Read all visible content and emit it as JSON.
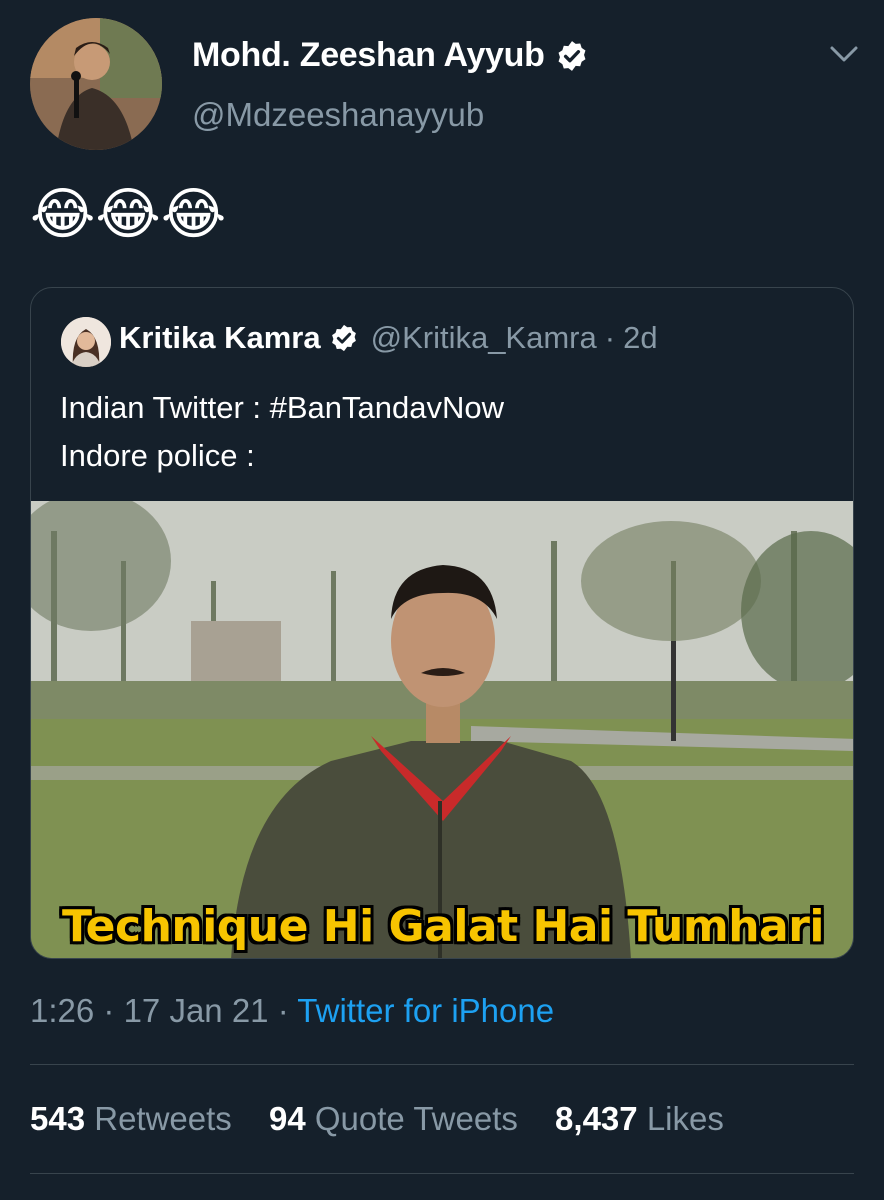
{
  "tweet": {
    "author": {
      "name": "Mohd. Zeeshan Ayyub",
      "handle": "@Mdzeeshanayyub"
    },
    "text": "😂😂😂",
    "quoted": {
      "name": "Kritika Kamra",
      "handle": "@Kritika_Kamra",
      "separator": "·",
      "age": "2d",
      "line1": "Indian Twitter : #BanTandavNow",
      "line2": "Indore police :",
      "image_caption": "Technique Hi Galat Hai Tumhari"
    },
    "time": "1:26",
    "date": "17 Jan 21",
    "separator": "·",
    "source": "Twitter for iPhone",
    "stats": {
      "retweets_count": "543",
      "retweets_label": "Retweets",
      "quotes_count": "94",
      "quotes_label": "Quote Tweets",
      "likes_count": "8,437",
      "likes_label": "Likes"
    }
  },
  "colors": {
    "background": "#15202b",
    "secondary_text": "#8899a6",
    "link": "#1da1f2",
    "border": "#38444d",
    "caption": "#f7c400"
  }
}
